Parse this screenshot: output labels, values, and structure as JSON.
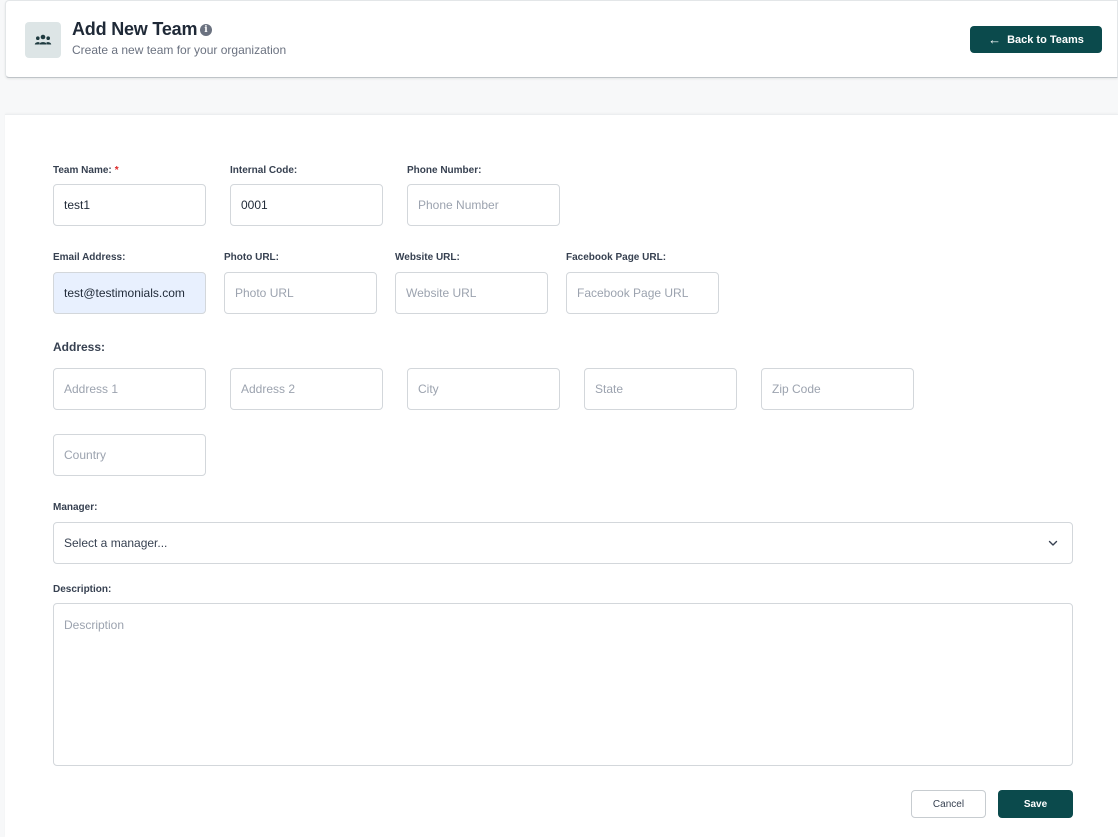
{
  "header": {
    "title": "Add New Team",
    "subtitle": "Create a new team for your organization",
    "team_icon": "team-icon",
    "info_icon": "info-icon",
    "back_button_label": "Back to Teams",
    "back_icon": "arrow-left-icon",
    "accent_color": "#0b4a4c"
  },
  "form": {
    "team_name": {
      "label": "Team Name:",
      "required_mark": "*",
      "value": "test1"
    },
    "internal_code": {
      "label": "Internal Code:",
      "value": "0001"
    },
    "phone_number": {
      "label": "Phone Number:",
      "placeholder": "Phone Number"
    },
    "email_address": {
      "label": "Email Address:",
      "value": "test@testimonials.com"
    },
    "photo_url": {
      "label": "Photo URL:",
      "placeholder": "Photo URL"
    },
    "website_url": {
      "label": "Website URL:",
      "placeholder": "Website URL"
    },
    "facebook_url": {
      "label": "Facebook Page URL:",
      "placeholder": "Facebook Page URL"
    },
    "address": {
      "label": "Address:",
      "address1_placeholder": "Address 1",
      "address2_placeholder": "Address 2",
      "city_placeholder": "City",
      "state_placeholder": "State",
      "zip_placeholder": "Zip Code",
      "country_placeholder": "Country"
    },
    "manager": {
      "label": "Manager:",
      "selected": "Select a manager...",
      "icon": "chevron-down-icon"
    },
    "description": {
      "label": "Description:",
      "placeholder": "Description"
    },
    "cancel_label": "Cancel",
    "save_label": "Save"
  }
}
